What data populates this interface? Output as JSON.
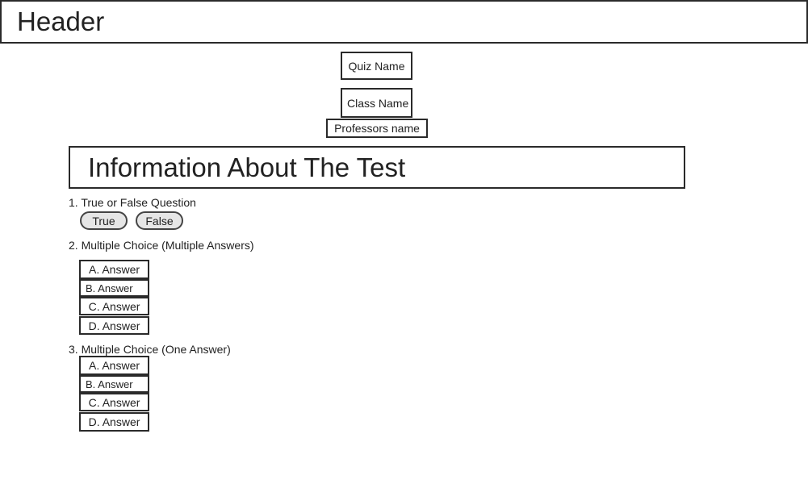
{
  "header": {
    "title": "Header"
  },
  "quiz": {
    "quiz_name": "Quiz Name",
    "class_name": "Class Name",
    "professor_name": "Professors name",
    "info_title": "Information About The Test"
  },
  "questions": [
    {
      "label": "1. True or False Question",
      "options": [
        "True",
        "False"
      ]
    },
    {
      "label": "2. Multiple Choice (Multiple Answers)",
      "options": [
        "A. Answer",
        "B. Answer",
        "C. Answer",
        "D. Answer"
      ]
    },
    {
      "label": "3. Multiple Choice (One Answer)",
      "options": [
        "A. Answer",
        "B. Answer",
        "C. Answer",
        "D. Answer"
      ]
    }
  ]
}
